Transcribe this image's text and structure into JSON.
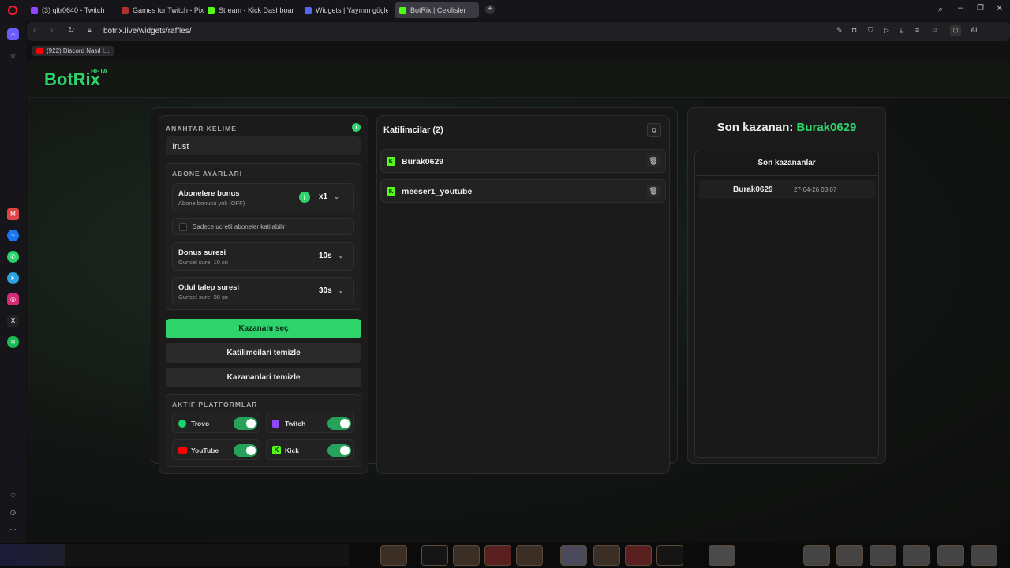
{
  "browser": {
    "tabs": [
      {
        "label": "(3) qltr0640 - Twitch",
        "color": "#9146ff"
      },
      {
        "label": "Games for Twitch - PixelP...",
        "color": "#b03030"
      },
      {
        "label": "Stream - Kick Dashboard",
        "color": "#53fc18"
      },
      {
        "label": "Widgets | Yayının güçlend...",
        "color": "#5865f2"
      },
      {
        "label": "BotRix | Cekilisler",
        "color": "#53fc18"
      }
    ],
    "url": "botrix.live/widgets/raffles/",
    "bookmark": "(922) Discord Nasıl İ...",
    "ai_label": "AI"
  },
  "brand": {
    "name": "BotRix",
    "badge": "BETA"
  },
  "settings": {
    "keyword_label": "ANAHTAR KELIME",
    "keyword_value": "!rust",
    "sub_settings_label": "ABONE AYARLARI",
    "sub_bonus": {
      "title": "Abonelere bonus",
      "subtitle": "Abone bonusu yok (OFF)",
      "value": "x1"
    },
    "only_paid_subs": "Sadece ucretli aboneler katilabilir",
    "spin_time": {
      "title": "Donus suresi",
      "subtitle": "Guncel sure: 10 sn",
      "value": "10s"
    },
    "claim_time": {
      "title": "Odul talep suresi",
      "subtitle": "Guncel sure: 30 sn",
      "value": "30s"
    },
    "pick_winner": "Kazananı seç",
    "clear_participants": "Katilimcilari temizle",
    "clear_winners": "Kazananlari temizle",
    "platforms_label": "AKTIF PLATFORMLAR",
    "platforms": [
      {
        "name": "Trovo",
        "color": "#19d66b",
        "enabled": true
      },
      {
        "name": "Twitch",
        "color": "#9146ff",
        "enabled": true
      },
      {
        "name": "YouTube",
        "color": "#ff0000",
        "enabled": true
      },
      {
        "name": "Kick",
        "color": "#53fc18",
        "enabled": true
      }
    ]
  },
  "participants": {
    "title": "Katilimcilar (2)",
    "list": [
      {
        "name": "Burak0629",
        "platform": "kick"
      },
      {
        "name": "meeser1_youtube",
        "platform": "kick"
      }
    ]
  },
  "winners": {
    "last_winner_label": "Son kazanan:",
    "last_winner_name": "Burak0629",
    "list_title": "Son kazananlar",
    "list": [
      {
        "name": "Burak0629",
        "date": "27-04-26 03:07"
      }
    ]
  },
  "colors": {
    "accent": "#2fd36b",
    "kick": "#53fc18"
  }
}
